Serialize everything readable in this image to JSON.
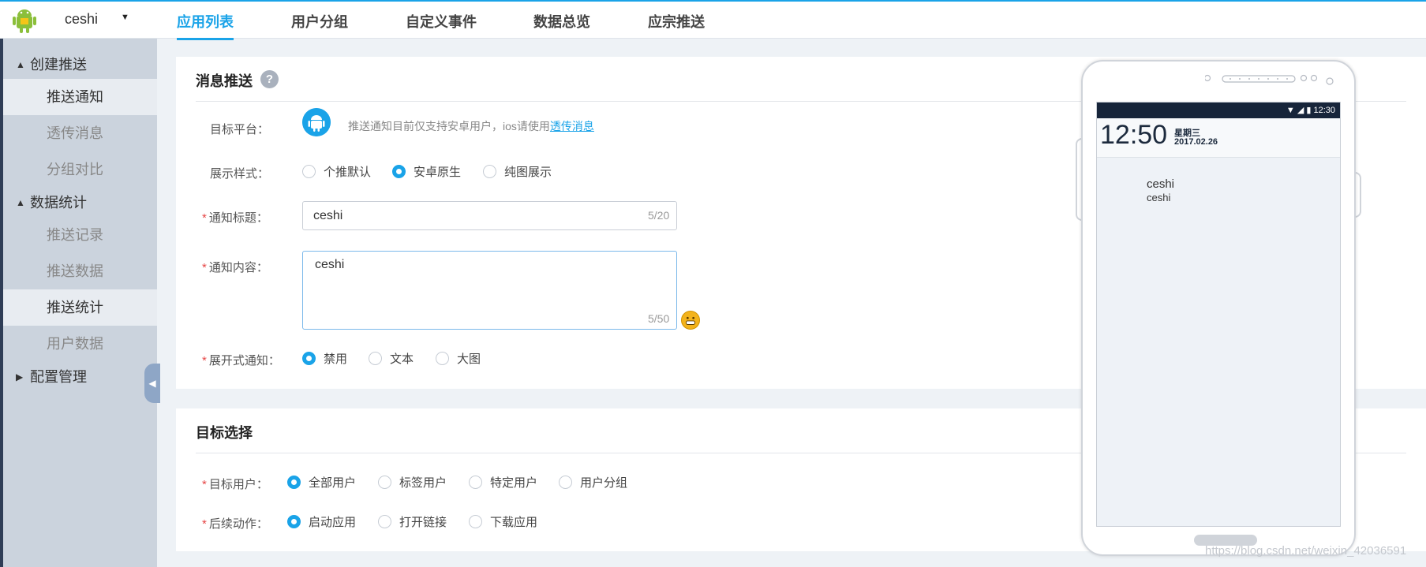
{
  "app": {
    "name": "ceshi"
  },
  "nav": {
    "tabs": [
      "应用列表",
      "用户分组",
      "自定义事件",
      "数据总览",
      "应宗推送"
    ]
  },
  "sidebar": {
    "group1": "创建推送",
    "group1_items": [
      "推送通知",
      "透传消息",
      "分组对比"
    ],
    "group2": "数据统计",
    "group2_items": [
      "推送记录",
      "推送数据",
      "推送统计",
      "用户数据"
    ],
    "group3": "配置管理"
  },
  "push": {
    "title": "消息推送",
    "help": "?",
    "platform_label": "目标平台：",
    "platform_note": "推送通知目前仅支持安卓用户，ios请使用",
    "platform_link": "透传消息",
    "style_label": "展示样式：",
    "style_options": [
      "个推默认",
      "安卓原生",
      "纯图展示"
    ],
    "title_label": "通知标题：",
    "title_value": "ceshi",
    "title_counter": "5/20",
    "content_label": "通知内容：",
    "content_value": "ceshi",
    "content_counter": "5/50",
    "expand_label": "展开式通知：",
    "expand_options": [
      "禁用",
      "文本",
      "大图"
    ],
    "required": "*"
  },
  "target": {
    "title": "目标选择",
    "users_label": "目标用户：",
    "users_options": [
      "全部用户",
      "标签用户",
      "特定用户",
      "用户分组"
    ],
    "action_label": "后续动作：",
    "action_options": [
      "启动应用",
      "打开链接",
      "下载应用"
    ]
  },
  "phone": {
    "status_time": "12:30",
    "clock": "12:50",
    "weekday": "星期三",
    "date": "2017.02.26",
    "notif_title": "ceshi",
    "notif_body": "ceshi"
  },
  "watermark": "https://blog.csdn.net/weixin_42036591",
  "colors": {
    "accent": "#1aa3e8",
    "sidebar": "#cbd3dd",
    "required": "#e64545"
  }
}
